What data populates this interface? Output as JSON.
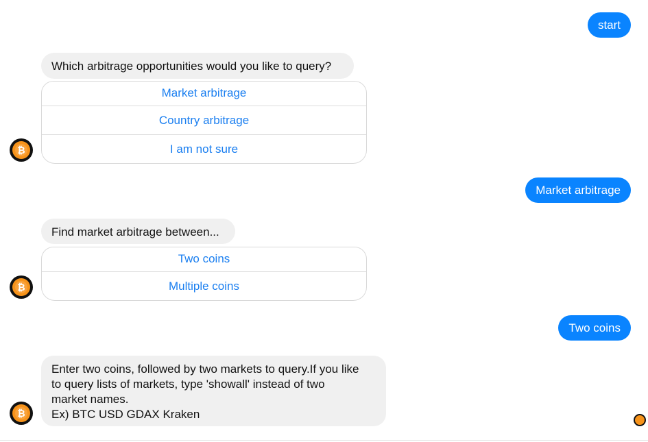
{
  "messages": {
    "out_start": "start",
    "in_q1": "Which arbitrage opportunities would you like to query?",
    "q1_replies": [
      "Market arbitrage",
      "Country arbitrage",
      "I am not sure"
    ],
    "out_market": "Market arbitrage",
    "in_q2": "Find market arbitrage between...",
    "q2_replies": [
      "Two coins",
      "Multiple coins"
    ],
    "out_two": "Two coins",
    "in_q3_lines": [
      "Enter two coins, followed by two markets to query.If you like",
      "to query lists of markets, type 'showall' instead of two",
      "market names.",
      "Ex) BTC USD GDAX Kraken"
    ]
  },
  "avatar": {
    "icon": "bitcoin-icon",
    "glyph": "₿",
    "color": "#f7931a"
  },
  "colors": {
    "outgoing_bubble": "#0a84ff",
    "incoming_bubble": "#f0f0f0",
    "quick_reply_text": "#1b7ff0"
  }
}
